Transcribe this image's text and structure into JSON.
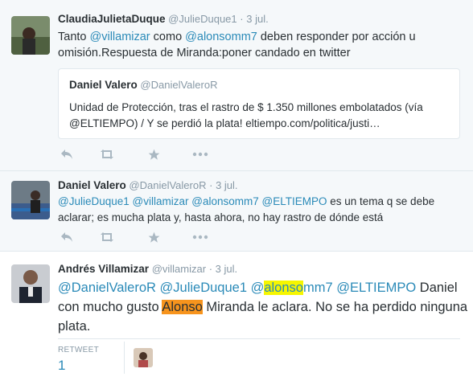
{
  "tweets": [
    {
      "name": "ClaudiaJulietaDuque",
      "handle": "@JulieDuque1",
      "time": "3 jul.",
      "text_parts": [
        "Tanto ",
        "@villamizar",
        " como ",
        "@alonsomm7",
        " deben responder por acción u omisión.Respuesta de Miranda:poner candado en twitter"
      ],
      "quote": {
        "name": "Daniel Valero",
        "handle": "@DanielValeroR",
        "line1": "Unidad de Protección, tras el rastro de $ 1.350 millones embolatados (vía",
        "line2": "@ELTIEMPO) / Y se perdió la plata!  eltiempo.com/politica/justi…"
      }
    },
    {
      "name": "Daniel Valero",
      "handle": "@DanielValeroR",
      "time": "3 jul.",
      "mentions": [
        "@JulieDuque1",
        "@villamizar",
        "@alonsomm7",
        "@ELTIEMPO"
      ],
      "text_rest": " es un tema q se debe",
      "line2": "aclarar; es mucha plata y, hasta ahora, no hay rastro de dónde está"
    },
    {
      "name": "Andrés Villamizar",
      "handle": "@villamizar",
      "time": "3 jul.",
      "mentions": [
        "@DanielValeroR",
        "@JulieDuque1"
      ],
      "m3_at": "@",
      "m3_hl": "alonso",
      "m3_rest": "mm7",
      "m4": "@ELTIEMPO",
      "line1_end": " Daniel",
      "line2_pre": "con mucho gusto ",
      "line2_hl": "Alonso",
      "line2_post": " Miranda le aclara. No se ha perdido ninguna",
      "line3": "plata.",
      "retweet_label": "RETWEET",
      "retweet_count": "1"
    }
  ],
  "icons": [
    "reply-icon",
    "retweet-icon",
    "favorite-icon",
    "more-icon"
  ],
  "colors": {
    "link": "#2a8ab8",
    "muted": "#8899a6",
    "icon": "#aab8c2",
    "highlight_yellow": "#f6f600",
    "highlight_orange": "#f7941d"
  }
}
